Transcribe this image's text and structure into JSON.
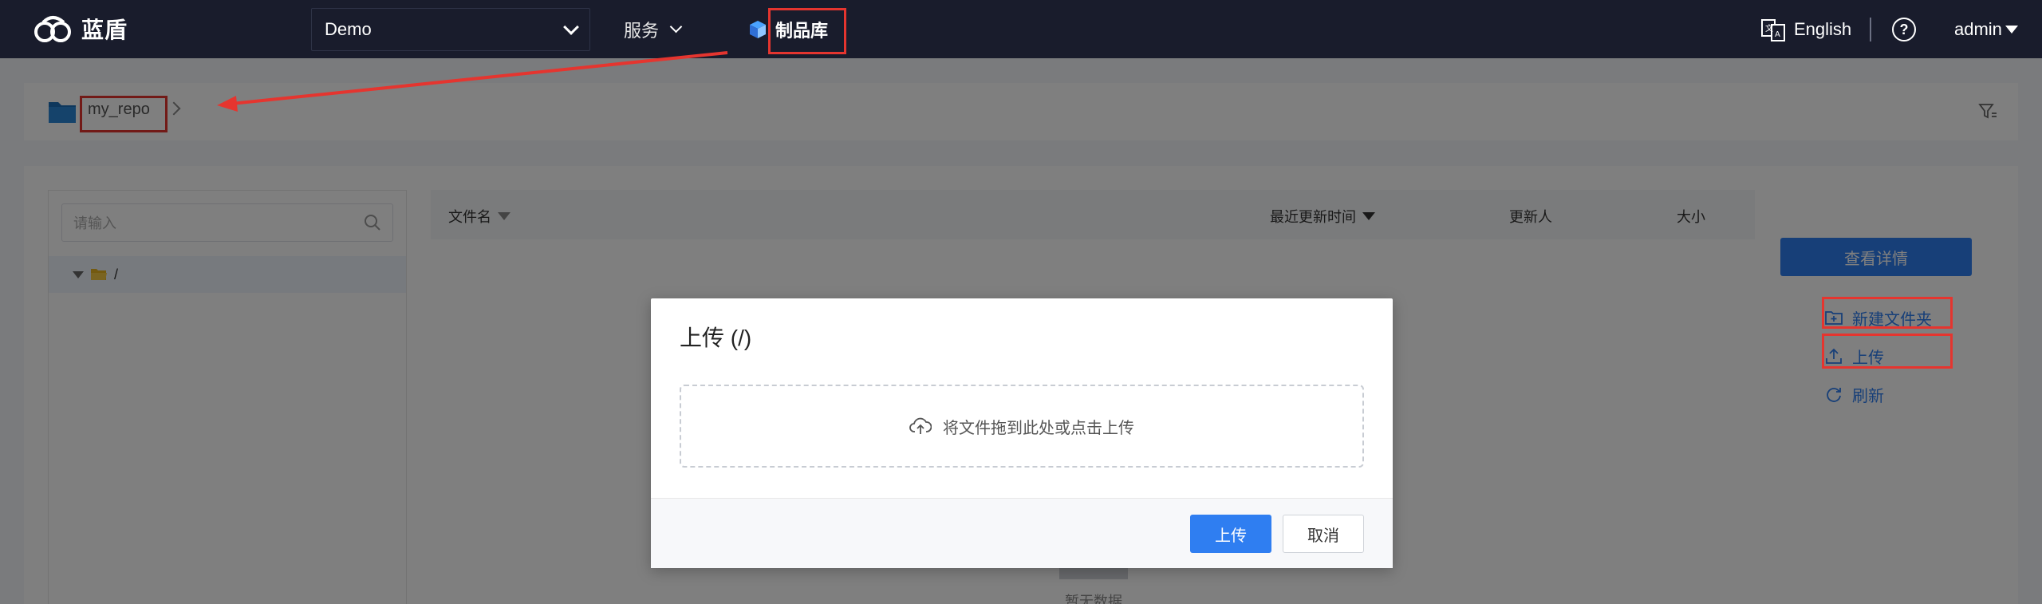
{
  "header": {
    "logo_text": "蓝盾",
    "project": "Demo",
    "services_label": "服务",
    "artifact_label": "制品库",
    "language_label": "English",
    "help_label": "?",
    "user_label": "admin"
  },
  "breadcrumb": {
    "repo": "my_repo"
  },
  "tree": {
    "search_placeholder": "请输入",
    "root_label": "/"
  },
  "table": {
    "columns": [
      "文件名",
      "最近更新时间",
      "更新人",
      "大小"
    ],
    "empty_text": "暂无数据"
  },
  "side_actions": {
    "detail_label": "查看详情",
    "new_folder_label": "新建文件夹",
    "upload_label": "上传",
    "refresh_label": "刷新"
  },
  "dialog": {
    "title": "上传 (/)",
    "dropzone_text": "将文件拖到此处或点击上传",
    "upload_button": "上传",
    "cancel_button": "取消"
  },
  "colors": {
    "nav_bg": "#191c2c",
    "accent": "#2f7ef1",
    "annotation_red": "#e5352f"
  }
}
